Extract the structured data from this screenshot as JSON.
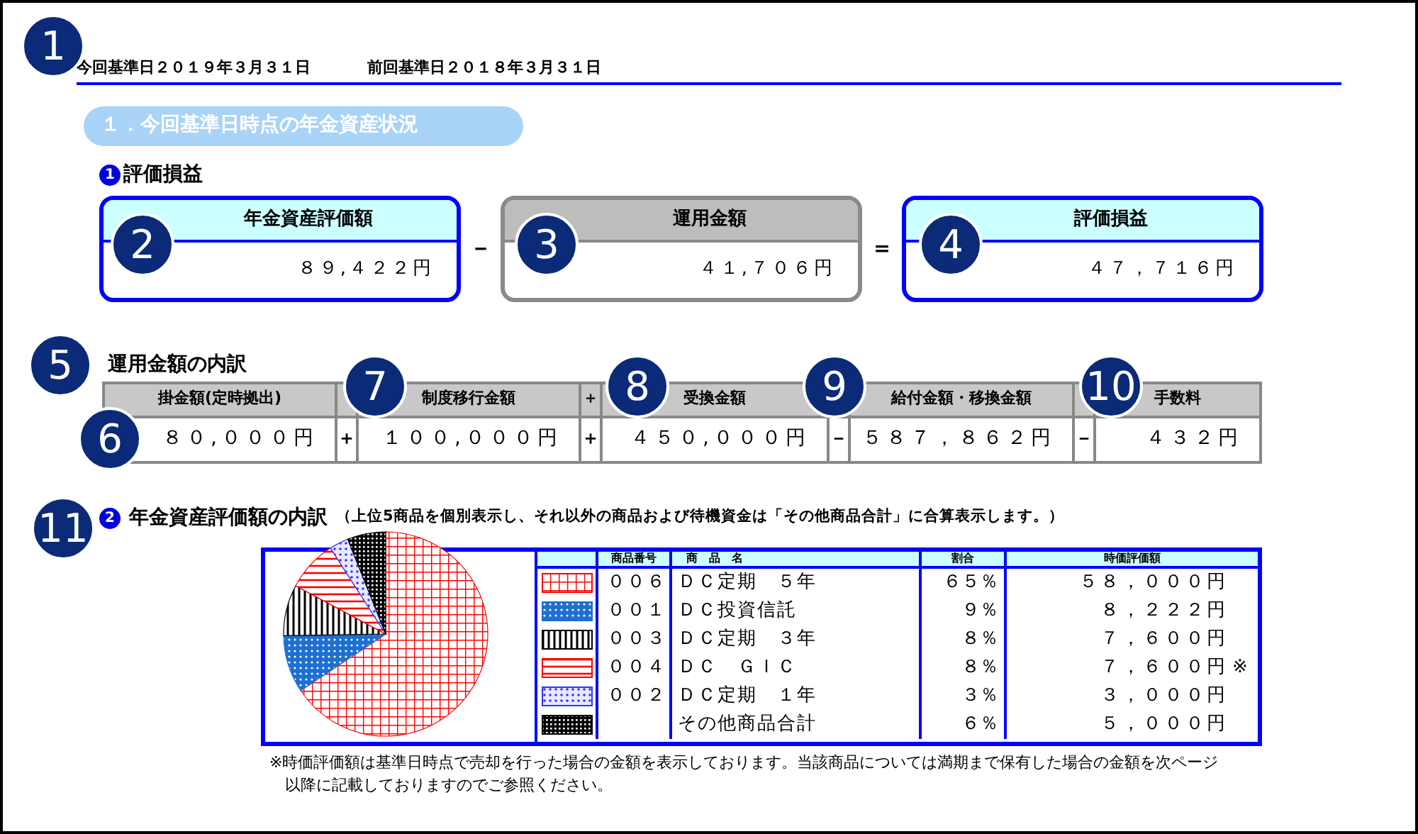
{
  "callouts": [
    {
      "label": "1"
    },
    {
      "label": "2"
    },
    {
      "label": "3"
    },
    {
      "label": "4"
    },
    {
      "label": "5"
    },
    {
      "label": "6"
    },
    {
      "label": "7"
    },
    {
      "label": "8"
    },
    {
      "label": "9"
    },
    {
      "label": "10"
    },
    {
      "label": "11"
    }
  ],
  "header": {
    "current": "今回基準日２０１９年３月３１日",
    "previous": "前回基準日２０１８年３月３１日"
  },
  "section_title": "１．今回基準日時点の年金資産状況",
  "valuation": {
    "badge": "1",
    "title": "評価損益",
    "operators": [
      "－",
      "＝"
    ],
    "boxes": [
      {
        "label": "年金資産評価額",
        "value": "８９,４２２円",
        "kind": "blue"
      },
      {
        "label": "運用金額",
        "value": "４１,７０６円",
        "kind": "gray"
      },
      {
        "label": "評価損益",
        "value": "４７，７１６円",
        "kind": "blue"
      }
    ]
  },
  "breakdown": {
    "title": "運用金額の内訳",
    "columns": [
      {
        "label": "掛金額(定時拠出)",
        "value": "８０,０００円"
      },
      {
        "label": "制度移行金額",
        "value": "１００,０００円",
        "operator": "＋"
      },
      {
        "label": "受換金額",
        "value": "４５０,０００円",
        "operator": "＋",
        "header_operator": "＋"
      },
      {
        "label": "給付金額・移換金額",
        "value": "５８７，８６２円",
        "operator": "－"
      },
      {
        "label": "手数料",
        "value": "４３２円",
        "operator": "－"
      }
    ]
  },
  "assets": {
    "badge": "2",
    "title": "年金資産評価額の内訳",
    "note": "（上位5商品を個別表示し、それ以外の商品および待機資金は「その他商品合計」に合算表示します。）",
    "chart_data": {
      "type": "pie",
      "values": [
        65,
        9,
        8,
        8,
        3,
        6
      ]
    },
    "columns": [
      "商品番号",
      "商　品　名",
      "割合",
      "時価評価額"
    ],
    "rows": [
      {
        "code": "００６",
        "name": "ＤＣ定期　５年",
        "share": "６５％",
        "value": "５８，０００円",
        "kind": "grid",
        "color": "#ff0000"
      },
      {
        "code": "００１",
        "name": "ＤＣ投資信託",
        "share": "９％",
        "value": "８，２２２円",
        "kind": "dots",
        "color": "#1e6fd0"
      },
      {
        "code": "００３",
        "name": "ＤＣ定期　３年",
        "share": "８％",
        "value": "７，６００円",
        "kind": "vstripes",
        "color": "#000000"
      },
      {
        "code": "００４",
        "name": "ＤＣ　ＧＩＣ",
        "share": "８％",
        "value": "７，６００円",
        "mark": "※",
        "kind": "hstripes",
        "color": "#ff0000"
      },
      {
        "code": "００２",
        "name": "ＤＣ定期　１年",
        "share": "３％",
        "value": "３，０００円",
        "kind": "sparse",
        "color": "#3333ff"
      },
      {
        "name": "その他商品合計",
        "share": "６％",
        "value": "５，０００円",
        "kind": "checker",
        "color": "#000000"
      }
    ],
    "footnote": "※時価評価額は基準日時点で売却を行った場合の金額を表示しております。当該商品については満期まで保有した場合の金額を次ページ以降に記載しておりますのでご参照ください。"
  }
}
